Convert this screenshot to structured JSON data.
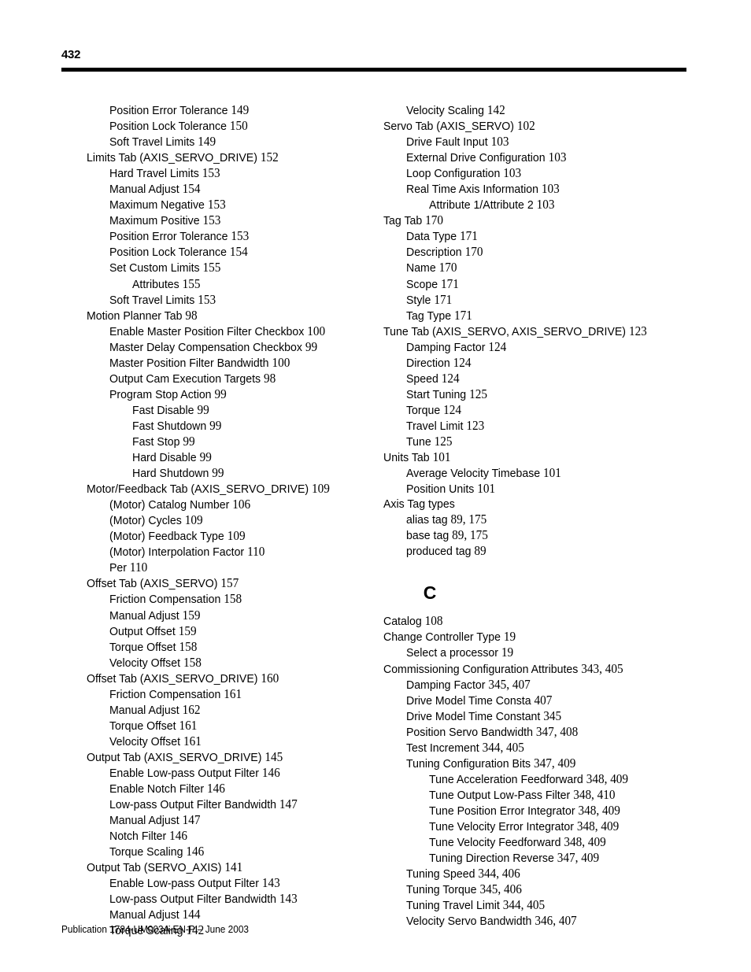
{
  "header": {
    "page_number": "432"
  },
  "footer": {
    "publication": "Publication 1784-UM003A-EN-P – June 2003"
  },
  "left_column": {
    "entries": [
      {
        "level": 1,
        "text": "Position Error Tolerance",
        "page": "149"
      },
      {
        "level": 1,
        "text": "Position Lock Tolerance",
        "page": "150"
      },
      {
        "level": 1,
        "text": "Soft Travel Limits",
        "page": "149"
      },
      {
        "level": 0,
        "text": "Limits Tab (AXIS_SERVO_DRIVE)",
        "page": "152"
      },
      {
        "level": 1,
        "text": "Hard Travel Limits",
        "page": "153"
      },
      {
        "level": 1,
        "text": "Manual Adjust",
        "page": "154"
      },
      {
        "level": 1,
        "text": "Maximum Negative",
        "page": "153"
      },
      {
        "level": 1,
        "text": "Maximum Positive",
        "page": "153"
      },
      {
        "level": 1,
        "text": "Position Error Tolerance",
        "page": "153"
      },
      {
        "level": 1,
        "text": "Position Lock Tolerance",
        "page": "154"
      },
      {
        "level": 1,
        "text": "Set Custom Limits",
        "page": "155"
      },
      {
        "level": 2,
        "text": "Attributes",
        "page": "155"
      },
      {
        "level": 1,
        "text": "Soft Travel Limits",
        "page": "153"
      },
      {
        "level": 0,
        "text": "Motion Planner Tab",
        "page": "98"
      },
      {
        "level": 1,
        "text": "Enable Master Position Filter Checkbox",
        "page": "100"
      },
      {
        "level": 1,
        "text": "Master Delay Compensation Checkbox",
        "page": "99"
      },
      {
        "level": 1,
        "text": "Master Position Filter Bandwidth",
        "page": "100"
      },
      {
        "level": 1,
        "text": "Output Cam Execution Targets",
        "page": "98"
      },
      {
        "level": 1,
        "text": "Program Stop Action",
        "page": "99"
      },
      {
        "level": 2,
        "text": "Fast Disable",
        "page": "99"
      },
      {
        "level": 2,
        "text": "Fast Shutdown",
        "page": "99"
      },
      {
        "level": 2,
        "text": "Fast Stop",
        "page": "99"
      },
      {
        "level": 2,
        "text": "Hard Disable",
        "page": "99"
      },
      {
        "level": 2,
        "text": "Hard Shutdown",
        "page": "99"
      },
      {
        "level": 0,
        "text": "Motor/Feedback Tab (AXIS_SERVO_DRIVE)",
        "page": "109"
      },
      {
        "level": 1,
        "text": "(Motor) Catalog Number",
        "page": "106"
      },
      {
        "level": 1,
        "text": "(Motor) Cycles",
        "page": "109"
      },
      {
        "level": 1,
        "text": "(Motor) Feedback Type",
        "page": "109"
      },
      {
        "level": 1,
        "text": "(Motor) Interpolation Factor",
        "page": "110"
      },
      {
        "level": 1,
        "text": "Per",
        "page": "110"
      },
      {
        "level": 0,
        "text": "Offset Tab (AXIS_SERVO)",
        "page": "157"
      },
      {
        "level": 1,
        "text": "Friction Compensation",
        "page": "158"
      },
      {
        "level": 1,
        "text": "Manual Adjust",
        "page": "159"
      },
      {
        "level": 1,
        "text": "Output Offset",
        "page": "159"
      },
      {
        "level": 1,
        "text": "Torque Offset",
        "page": "158"
      },
      {
        "level": 1,
        "text": "Velocity Offset",
        "page": "158"
      },
      {
        "level": 0,
        "text": "Offset Tab (AXIS_SERVO_DRIVE)",
        "page": "160"
      },
      {
        "level": 1,
        "text": "Friction Compensation",
        "page": "161"
      },
      {
        "level": 1,
        "text": "Manual Adjust",
        "page": "162"
      },
      {
        "level": 1,
        "text": "Torque Offset",
        "page": "161"
      },
      {
        "level": 1,
        "text": "Velocity Offset",
        "page": "161"
      },
      {
        "level": 0,
        "text": "Output Tab (AXIS_SERVO_DRIVE)",
        "page": "145"
      },
      {
        "level": 1,
        "text": "Enable Low-pass Output Filter",
        "page": "146"
      },
      {
        "level": 1,
        "text": "Enable Notch Filter",
        "page": "146"
      },
      {
        "level": 1,
        "text": "Low-pass Output Filter Bandwidth",
        "page": "147"
      },
      {
        "level": 1,
        "text": "Manual Adjust",
        "page": "147"
      },
      {
        "level": 1,
        "text": "Notch Filter",
        "page": "146"
      },
      {
        "level": 1,
        "text": "Torque Scaling",
        "page": "146"
      },
      {
        "level": 0,
        "text": "Output Tab (SERVO_AXIS)",
        "page": "141"
      },
      {
        "level": 1,
        "text": "Enable Low-pass Output Filter",
        "page": "143"
      },
      {
        "level": 1,
        "text": "Low-pass Output Filter Bandwidth",
        "page": "143"
      },
      {
        "level": 1,
        "text": "Manual Adjust",
        "page": "144"
      },
      {
        "level": 1,
        "text": "Torque Scaling",
        "page": "142"
      }
    ]
  },
  "right_column": {
    "entries_before_section": [
      {
        "level": 1,
        "text": "Velocity Scaling",
        "page": "142"
      },
      {
        "level": 0,
        "text": "Servo Tab (AXIS_SERVO)",
        "page": "102"
      },
      {
        "level": 1,
        "text": "Drive Fault Input",
        "page": "103"
      },
      {
        "level": 1,
        "text": "External Drive Configuration",
        "page": "103"
      },
      {
        "level": 1,
        "text": "Loop Configuration",
        "page": "103"
      },
      {
        "level": 1,
        "text": "Real Time Axis Information",
        "page": "103"
      },
      {
        "level": 2,
        "text": "Attribute 1/Attribute 2",
        "page": "103"
      },
      {
        "level": 0,
        "text": "Tag Tab",
        "page": "170"
      },
      {
        "level": 1,
        "text": "Data Type",
        "page": "171"
      },
      {
        "level": 1,
        "text": "Description",
        "page": "170"
      },
      {
        "level": 1,
        "text": "Name",
        "page": "170"
      },
      {
        "level": 1,
        "text": "Scope",
        "page": "171"
      },
      {
        "level": 1,
        "text": "Style",
        "page": "171"
      },
      {
        "level": 1,
        "text": "Tag Type",
        "page": "171"
      },
      {
        "level": 0,
        "text": "Tune Tab (AXIS_SERVO, AXIS_SERVO_DRIVE)",
        "page": "123"
      },
      {
        "level": 1,
        "text": "Damping Factor",
        "page": "124"
      },
      {
        "level": 1,
        "text": "Direction",
        "page": "124"
      },
      {
        "level": 1,
        "text": "Speed",
        "page": "124"
      },
      {
        "level": 1,
        "text": "Start Tuning",
        "page": "125"
      },
      {
        "level": 1,
        "text": "Torque",
        "page": "124"
      },
      {
        "level": 1,
        "text": "Travel Limit",
        "page": "123"
      },
      {
        "level": 1,
        "text": "Tune",
        "page": "125"
      },
      {
        "level": 0,
        "text": "Units Tab",
        "page": "101"
      },
      {
        "level": 1,
        "text": "Average Velocity Timebase",
        "page": "101"
      },
      {
        "level": 1,
        "text": "Position Units",
        "page": "101"
      },
      {
        "level": 0,
        "text": "Axis Tag types",
        "page": ""
      },
      {
        "level": 1,
        "text": "alias tag",
        "page": "89, 175"
      },
      {
        "level": 1,
        "text": "base tag",
        "page": "89, 175"
      },
      {
        "level": 1,
        "text": "produced tag",
        "page": "89"
      }
    ],
    "section_letter": "C",
    "entries_after_section": [
      {
        "level": 0,
        "text": "Catalog",
        "page": "108"
      },
      {
        "level": 0,
        "text": "Change Controller Type",
        "page": "19"
      },
      {
        "level": 1,
        "text": "Select a processor",
        "page": "19"
      },
      {
        "level": 0,
        "text": "Commissioning Configuration Attributes",
        "page": "343, 405"
      },
      {
        "level": 1,
        "text": "Damping Factor",
        "page": "345, 407"
      },
      {
        "level": 1,
        "text": "Drive Model Time Consta",
        "page": "407"
      },
      {
        "level": 1,
        "text": "Drive Model Time Constant",
        "page": "345"
      },
      {
        "level": 1,
        "text": "Position Servo Bandwidth",
        "page": "347, 408"
      },
      {
        "level": 1,
        "text": "Test Increment",
        "page": "344, 405"
      },
      {
        "level": 1,
        "text": "Tuning Configuration Bits",
        "page": "347, 409"
      },
      {
        "level": 2,
        "text": "Tune Acceleration Feedforward",
        "page": "348, 409"
      },
      {
        "level": 2,
        "text": "Tune Output Low-Pass Filter",
        "page": "348, 410"
      },
      {
        "level": 2,
        "text": "Tune Position Error Integrator",
        "page": "348, 409"
      },
      {
        "level": 2,
        "text": "Tune Velocity Error Integrator",
        "page": "348, 409"
      },
      {
        "level": 2,
        "text": "Tune Velocity Feedforward",
        "page": "348, 409"
      },
      {
        "level": 2,
        "text": "Tuning Direction Reverse",
        "page": "347, 409"
      },
      {
        "level": 1,
        "text": "Tuning Speed",
        "page": "344, 406"
      },
      {
        "level": 1,
        "text": "Tuning Torque",
        "page": "345, 406"
      },
      {
        "level": 1,
        "text": "Tuning Travel Limit",
        "page": "344, 405"
      },
      {
        "level": 1,
        "text": "Velocity Servo Bandwidth",
        "page": "346, 407"
      }
    ]
  }
}
